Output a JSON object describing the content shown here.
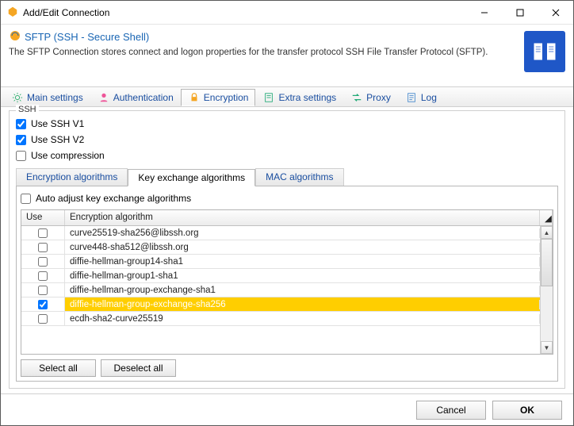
{
  "window": {
    "title": "Add/Edit Connection"
  },
  "header": {
    "title": "SFTP (SSH - Secure Shell)",
    "desc": "The SFTP Connection stores connect and logon properties for the transfer protocol SSH File Transfer Protocol (SFTP)."
  },
  "main_tabs": {
    "items": [
      {
        "label": "Main settings",
        "icon": "gear"
      },
      {
        "label": "Authentication",
        "icon": "user"
      },
      {
        "label": "Encryption",
        "icon": "lock",
        "active": true
      },
      {
        "label": "Extra settings",
        "icon": "sheet"
      },
      {
        "label": "Proxy",
        "icon": "arrows"
      },
      {
        "label": "Log",
        "icon": "log"
      }
    ]
  },
  "group": {
    "title": "SSH"
  },
  "checks": {
    "ssh_v1": {
      "label": "Use SSH V1",
      "checked": true
    },
    "ssh_v2": {
      "label": "Use SSH V2",
      "checked": true
    },
    "compression": {
      "label": "Use compression",
      "checked": false
    }
  },
  "sub_tabs": {
    "items": [
      {
        "label": "Encryption algorithms"
      },
      {
        "label": "Key exchange algorithms",
        "active": true
      },
      {
        "label": "MAC algorithms"
      }
    ]
  },
  "auto_adjust": {
    "label": "Auto adjust key exchange algorithms",
    "checked": false
  },
  "table": {
    "col_use": "Use",
    "col_alg": "Encryption algorithm",
    "rows": [
      {
        "checked": false,
        "name": "curve25519-sha256@libssh.org"
      },
      {
        "checked": false,
        "name": "curve448-sha512@libssh.org"
      },
      {
        "checked": false,
        "name": "diffie-hellman-group14-sha1"
      },
      {
        "checked": false,
        "name": "diffie-hellman-group1-sha1"
      },
      {
        "checked": false,
        "name": "diffie-hellman-group-exchange-sha1"
      },
      {
        "checked": true,
        "name": "diffie-hellman-group-exchange-sha256",
        "selected": true
      },
      {
        "checked": false,
        "name": "ecdh-sha2-curve25519"
      }
    ]
  },
  "buttons": {
    "select_all": "Select all",
    "deselect_all": "Deselect all",
    "cancel": "Cancel",
    "ok": "OK"
  }
}
